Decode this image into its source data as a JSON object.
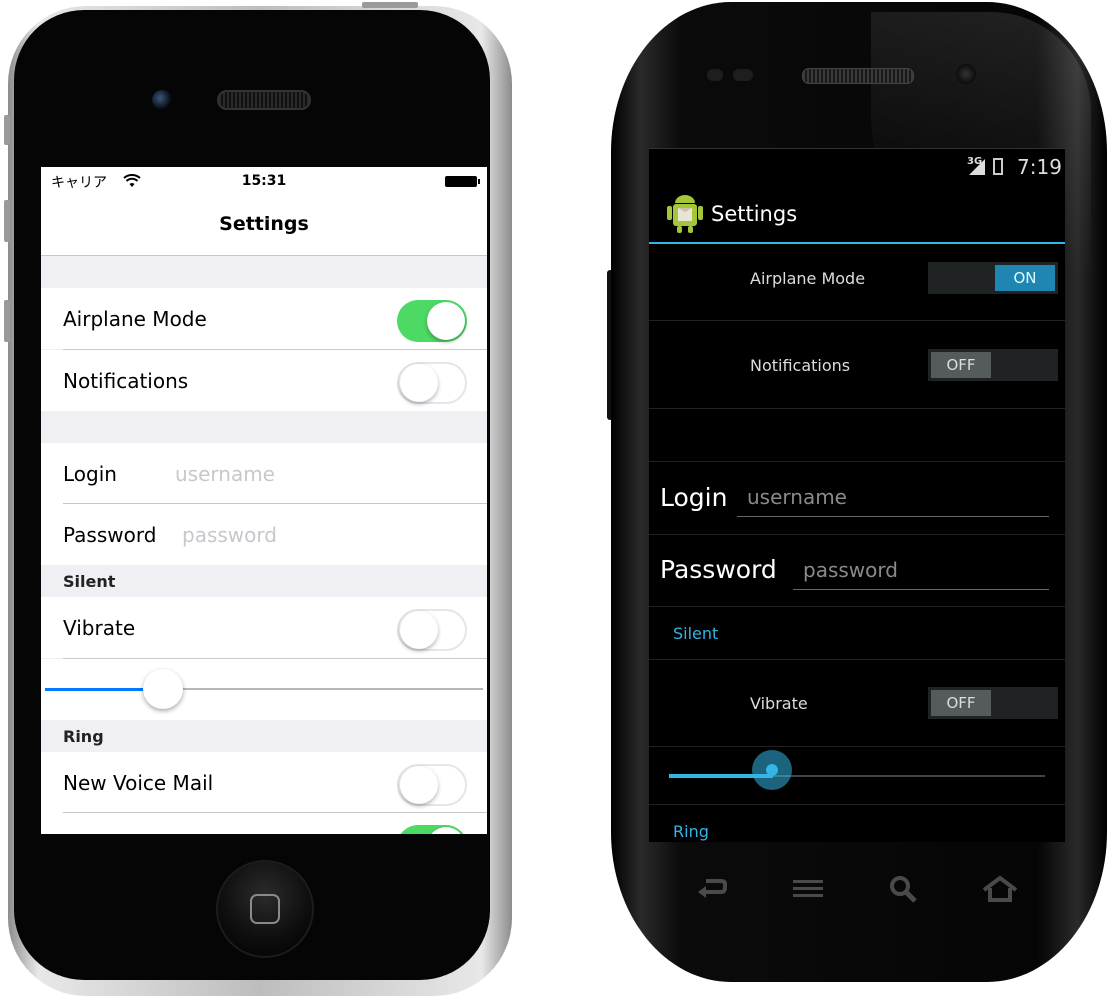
{
  "ios": {
    "status": {
      "carrier": "キャリア",
      "time": "15:31"
    },
    "nav_title": "Settings",
    "cells": {
      "airplane": {
        "label": "Airplane Mode",
        "on": true
      },
      "notifications": {
        "label": "Notifications",
        "on": false
      },
      "login": {
        "label": "Login",
        "placeholder": "username"
      },
      "password": {
        "label": "Password",
        "placeholder": "password"
      },
      "vibrate": {
        "label": "Vibrate",
        "on": false
      },
      "voicemail": {
        "label": "New Voice Mail",
        "on": false
      },
      "next_cell_toggle_on": true
    },
    "sections": {
      "silent": "Silent",
      "ring": "Ring"
    },
    "slider_value": 0.27,
    "colors": {
      "switch_on": "#4cd964",
      "tint": "#007aff"
    }
  },
  "android": {
    "status": {
      "network": "3G",
      "time": "7:19"
    },
    "action_title": "Settings",
    "airplane": {
      "label": "Airplane Mode",
      "state": "ON"
    },
    "notifications": {
      "label": "Notifications",
      "state": "OFF"
    },
    "login": {
      "label": "Login",
      "placeholder": "username"
    },
    "password": {
      "label": "Password",
      "placeholder": "password"
    },
    "sections": {
      "silent": "Silent",
      "ring": "Ring"
    },
    "vibrate": {
      "label": "Vibrate",
      "state": "OFF"
    },
    "slider_value": 0.27,
    "nav_icons": [
      "back-icon",
      "menu-icon",
      "search-icon",
      "home-icon"
    ],
    "colors": {
      "accent": "#33b5e5"
    }
  }
}
